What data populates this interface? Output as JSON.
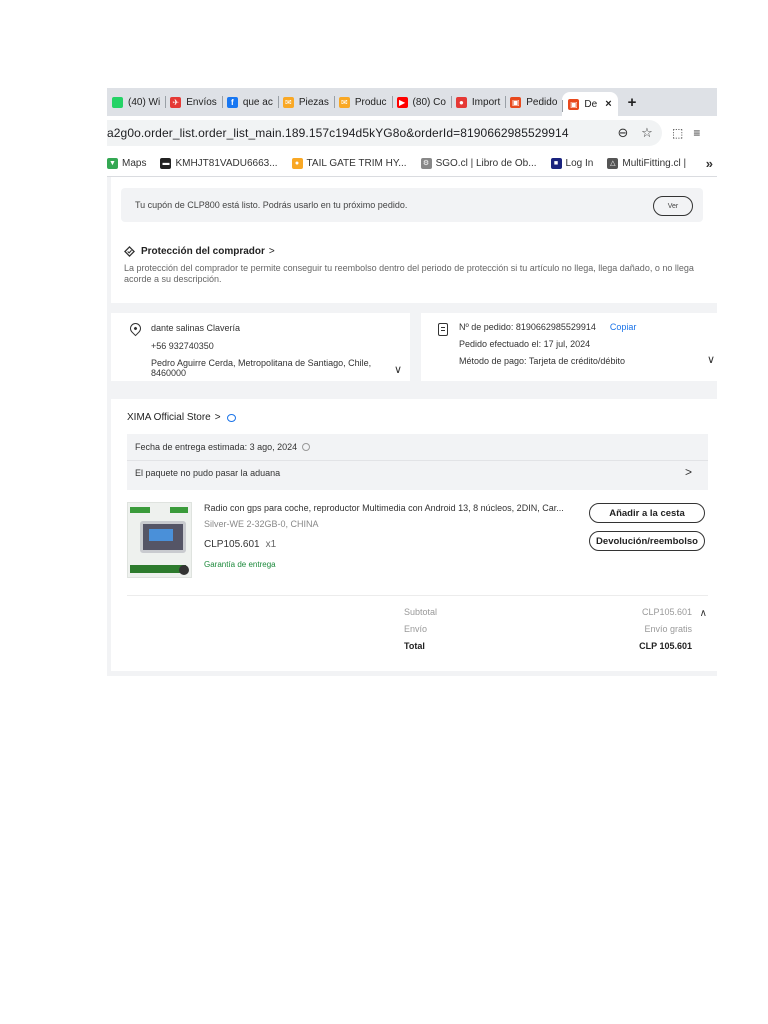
{
  "browser": {
    "tabs": [
      {
        "label": "(40) Wi",
        "color": "#25d366",
        "glyph": ""
      },
      {
        "label": "Envíos",
        "color": "#e53935",
        "glyph": "✈"
      },
      {
        "label": "que ac",
        "color": "#1877f2",
        "glyph": "f"
      },
      {
        "label": "Piezas",
        "color": "#f9a825",
        "glyph": "✉"
      },
      {
        "label": "Produc",
        "color": "#f9a825",
        "glyph": "✉"
      },
      {
        "label": "(80) Co",
        "color": "#ff0000",
        "glyph": "▶"
      },
      {
        "label": "Import",
        "color": "#e53935",
        "glyph": "●"
      },
      {
        "label": "Pedido",
        "color": "#e8491d",
        "glyph": "▣"
      }
    ],
    "active_tab": {
      "label": "De",
      "color": "#e8491d",
      "glyph": "▣"
    },
    "close_glyph": "×",
    "new_tab_glyph": "+",
    "url": "a2g0o.order_list.order_list_main.189.157c194d5kYG8o&orderId=8190662985529914",
    "zoom_glyph": "⊖",
    "star_glyph": "☆",
    "extensions_glyph": "⬚",
    "media_glyph": "≡",
    "bookmarks": [
      {
        "label": "Maps",
        "color": "#34a853",
        "glyph": "▼"
      },
      {
        "label": "KMHJT81VADU6663...",
        "color": "#222222",
        "glyph": "▬"
      },
      {
        "label": "TAIL GATE TRIM HY...",
        "color": "#f9a825",
        "glyph": "●"
      },
      {
        "label": "SGO.cl | Libro de Ob...",
        "color": "#888888",
        "glyph": "⚙"
      },
      {
        "label": "Log In",
        "color": "#1a237e",
        "glyph": "■"
      },
      {
        "label": "MultiFitting.cl |",
        "color": "#555555",
        "glyph": "△"
      }
    ],
    "bookmarks_more": "»"
  },
  "coupon": {
    "text": "Tu cupón de CLP800 está listo. Podrás usarlo en tu próximo pedido.",
    "button": "Ver"
  },
  "protection": {
    "title": "Protección del comprador",
    "chevron": ">",
    "text": "La protección del comprador te permite conseguir tu reembolso dentro del periodo de protección si tu artículo no llega, llega dañado, o no llega acorde a su descripción."
  },
  "address": {
    "name": "dante salinas Clavería",
    "phone": "+56 932740350",
    "line": "Pedro Aguirre Cerda, Metropolitana de Santiago, Chile, 8460000",
    "chevron": "∨"
  },
  "order": {
    "number": "Nº de pedido: 8190662985529914",
    "copy": "Copiar",
    "placed": "Pedido efectuado el: 17 jul, 2024",
    "payment": "Método de pago: Tarjeta de crédito/débito",
    "chevron": "∨"
  },
  "store": {
    "name": "XIMA Official Store",
    "chevron": ">",
    "delivery_estimate": "Fecha de entrega estimada: 3 ago, 2024",
    "status": "El paquete no pudo pasar la aduana",
    "status_chevron": ">"
  },
  "product": {
    "title": "Radio con gps para coche, reproductor Multimedia con Android 13, 8 núcleos, 2DIN, Car...",
    "variant": "Silver-WE 2-32GB-0, CHINA",
    "price": "CLP105.601",
    "qty": "x1",
    "guarantee": "Garantía de entrega",
    "add_to_cart": "Añadir a la cesta",
    "refund": "Devolución/reembolso"
  },
  "summary": {
    "subtotal_label": "Subtotal",
    "subtotal_value": "CLP105.601",
    "shipping_label": "Envío",
    "shipping_value": "Envío gratis",
    "total_label": "Total",
    "total_value": "CLP 105.601",
    "collapse": "∧"
  }
}
